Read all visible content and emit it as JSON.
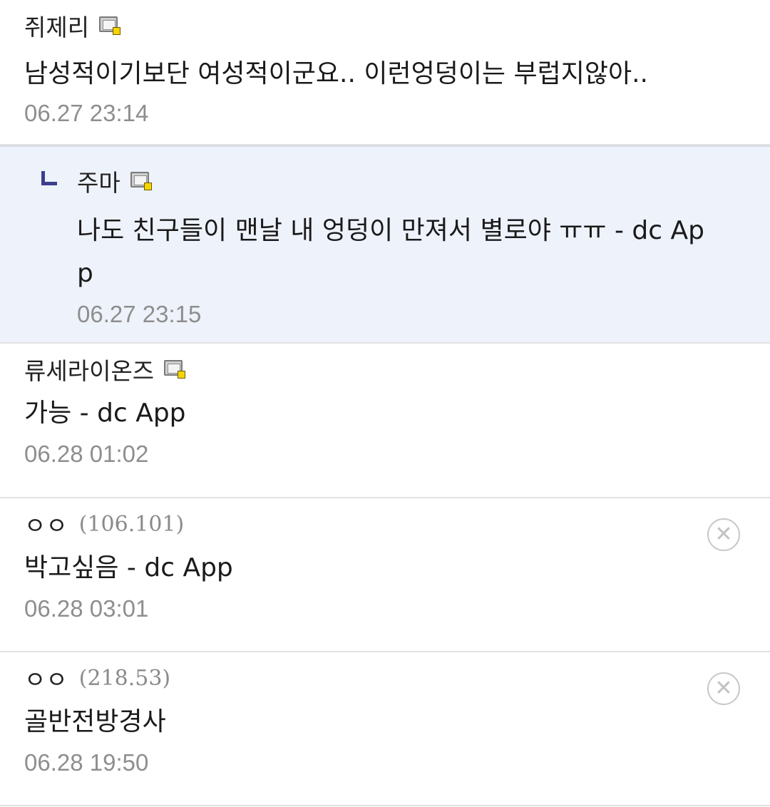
{
  "comments": [
    {
      "nickname": "쥐제리",
      "text": "남성적이기보단 여성적이군요.. 이런엉덩이는 부럽지않아..",
      "date": "06.27 23:14"
    },
    {
      "nickname": "주마",
      "text": "나도 친구들이 맨날 내 엉덩이 만져서 별로야 ㅠㅠ - dc Ap\np",
      "date": "06.27 23:15"
    },
    {
      "nickname": "류세라이온즈",
      "text": "가능 - dc App",
      "date": "06.28 01:02"
    },
    {
      "nickname": "ㅇㅇ",
      "ip": "(106.101)",
      "text": "박고싶음 - dc App",
      "date": "06.28 03:01"
    },
    {
      "nickname": "ㅇㅇ",
      "ip": "(218.53)",
      "text": "골반전방경사",
      "date": "06.28 19:50"
    }
  ],
  "icons": {
    "fixed_nick": "fixed-nick-icon",
    "reply": "reply-arrow-icon",
    "delete": "delete-circle-x-icon"
  },
  "delete_glyph": "✕"
}
